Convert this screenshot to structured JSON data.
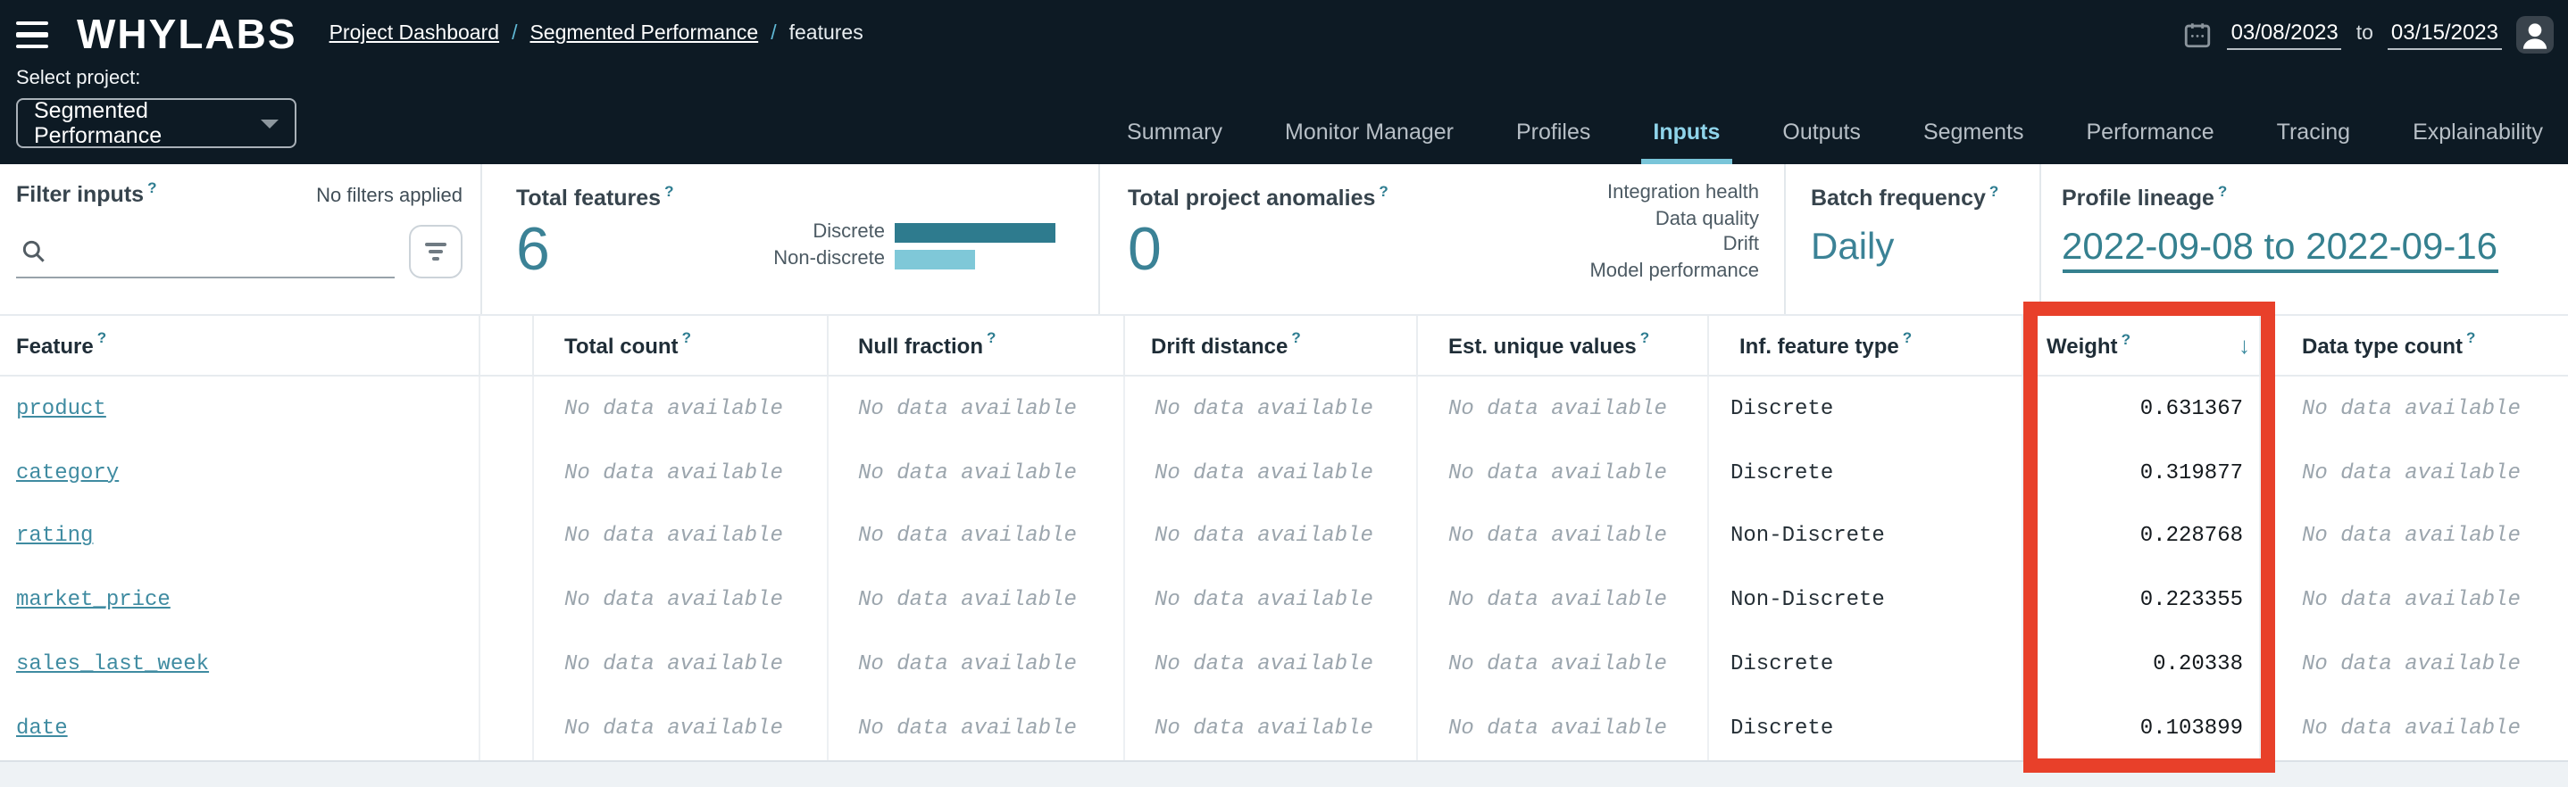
{
  "header": {
    "logo": "WHYLABS",
    "breadcrumbs": [
      {
        "label": "Project Dashboard",
        "link": true
      },
      {
        "label": "Segmented Performance",
        "link": true
      },
      {
        "label": "features",
        "link": false
      }
    ],
    "breadcrumb_separator": "/",
    "select_project_label": "Select project:",
    "project_selector_value": "Segmented Performance",
    "date_range": {
      "start": "03/08/2023",
      "separator": "to",
      "end": "03/15/2023"
    },
    "tabs": [
      "Summary",
      "Monitor Manager",
      "Profiles",
      "Inputs",
      "Outputs",
      "Segments",
      "Performance",
      "Tracing",
      "Explainability"
    ],
    "active_tab": "Inputs"
  },
  "summary": {
    "filter": {
      "title": "Filter inputs",
      "help": "?",
      "status": "No filters applied"
    },
    "total_features": {
      "title": "Total features",
      "value": "6",
      "bars": [
        {
          "label": "Discrete",
          "color": "#2E7B8E",
          "width": 90
        },
        {
          "label": "Non-discrete",
          "color": "#7FC8D8",
          "width": 45
        }
      ]
    },
    "anomalies": {
      "title": "Total project anomalies",
      "value": "0",
      "categories": [
        "Integration health",
        "Data quality",
        "Drift",
        "Model performance"
      ]
    },
    "batch_frequency": {
      "title": "Batch frequency",
      "value": "Daily"
    },
    "profile_lineage": {
      "title": "Profile lineage",
      "value": "2022-09-08 to 2022-09-16"
    }
  },
  "table": {
    "columns": [
      "Feature",
      "Total count",
      "Null fraction",
      "Drift distance",
      "Est. unique values",
      "Inf. feature type",
      "Weight",
      "Data type count"
    ],
    "sorted_column": "Weight",
    "sort_direction": "descending",
    "no_data_text": "No data available",
    "rows": [
      {
        "feature": "product",
        "inf_feature_type": "Discrete",
        "weight": "0.631367"
      },
      {
        "feature": "category",
        "inf_feature_type": "Discrete",
        "weight": "0.319877"
      },
      {
        "feature": "rating",
        "inf_feature_type": "Non-Discrete",
        "weight": "0.228768"
      },
      {
        "feature": "market_price",
        "inf_feature_type": "Non-Discrete",
        "weight": "0.223355"
      },
      {
        "feature": "sales_last_week",
        "inf_feature_type": "Discrete",
        "weight": "0.20338"
      },
      {
        "feature": "date",
        "inf_feature_type": "Discrete",
        "weight": "0.103899"
      }
    ]
  },
  "colors": {
    "header_bg": "#0D1A24",
    "accent_teal": "#2E7D91",
    "value_teal": "#3B8296",
    "active_tab": "#8FD4EA",
    "tab_underline": "#79C5D9",
    "bar_discrete": "#2E7B8E",
    "bar_non_discrete": "#7FC8D8",
    "highlight_red": "#E8402A",
    "no_data_gray": "#9BA5AD"
  }
}
